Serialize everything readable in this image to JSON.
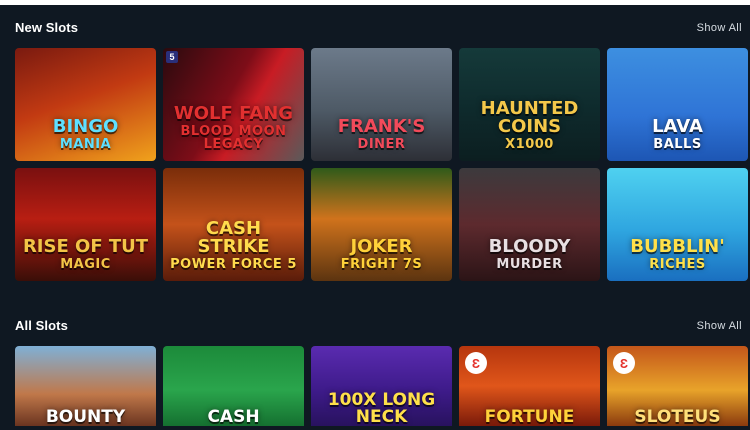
{
  "sections": {
    "new": {
      "title": "New Slots",
      "show_all": "Show All"
    },
    "all": {
      "title": "All Slots",
      "show_all": "Show All"
    }
  },
  "new_slots": [
    {
      "name": "BINGO",
      "sub": "MANIA",
      "bg": "linear-gradient(160deg,#7a1a10 0%,#c23a12 45%,#f0a21c 100%)",
      "color": "#5ee0ff"
    },
    {
      "name": "WOLF FANG",
      "sub": "BLOOD MOON LEGACY",
      "bg": "linear-gradient(120deg,#2a0a0e 0%,#7d0d18 45%,#c81c24 60%,#5a5a5a 100%)",
      "color": "#e23030",
      "badge": "5"
    },
    {
      "name": "Frank's",
      "sub": "DINER",
      "bg": "linear-gradient(180deg,#6c7a8a 0%,#4e5a66 55%,#2d2f36 100%)",
      "color": "#f24a5a"
    },
    {
      "name": "HAUNTED COINS",
      "sub": "x1000",
      "bg": "linear-gradient(180deg,#153a3a 0%,#0e2a2c 55%,#0c1e20 100%)",
      "color": "#f4c84a"
    },
    {
      "name": "LAVA",
      "sub": "BALLS",
      "bg": "linear-gradient(180deg,#3d8fe0 0%,#2f74d6 60%,#1d56b4 100%)",
      "color": "#ffffff"
    },
    {
      "name": "RISE of TUT",
      "sub": "MAGIC",
      "bg": "linear-gradient(180deg,#7a1010 0%,#b81e12 45%,#3a0e08 100%)",
      "color": "#f3c447"
    },
    {
      "name": "CASH STRIKE",
      "sub": "POWER FORCE 5",
      "bg": "linear-gradient(180deg,#7a2d0a 0%,#c4521a 50%,#5a1c0a 100%)",
      "color": "#ffdb4d"
    },
    {
      "name": "JOKER",
      "sub": "FRIGHT 7s",
      "bg": "linear-gradient(180deg,#2f5a1a 0%,#d0731c 45%,#5c3410 100%)",
      "color": "#ffd23a"
    },
    {
      "name": "BLOODY",
      "sub": "MURDER",
      "bg": "linear-gradient(180deg,#3c3a3d 0%,#5d2a2e 50%,#2b1416 100%)",
      "color": "#e8dfe2"
    },
    {
      "name": "BUBBLIN'",
      "sub": "RICHES",
      "bg": "linear-gradient(180deg,#4fd1f0 0%,#2fa6e0 55%,#1a6fc0 100%)",
      "color": "#ffe04a"
    }
  ],
  "all_slots": [
    {
      "name": "BOUNTY",
      "bg": "linear-gradient(180deg,#7fb0d6 0%,#c0784a 60%,#6a3420 100%)",
      "color": "#ffffff"
    },
    {
      "name": "CASH",
      "bg": "linear-gradient(180deg,#1c8a3a 0%,#2aa54c 55%,#157030 100%)",
      "color": "#ffffff"
    },
    {
      "name": "100x LONG NECK",
      "bg": "linear-gradient(180deg,#5a2bb0 0%,#3e1b8a 55%,#28125e 100%)",
      "color": "#ffe04a"
    },
    {
      "name": "FORTUNE",
      "bg": "linear-gradient(180deg,#b6360e 0%,#e0561a 50%,#7a1a0a 100%)",
      "color": "#ffd23a",
      "badge": "Ɛ"
    },
    {
      "name": "SLOTEUS",
      "bg": "linear-gradient(180deg,#c4561a 0%,#e8a32a 55%,#8a3a0e 100%)",
      "color": "#ffe07a",
      "badge": "Ɛ"
    }
  ]
}
